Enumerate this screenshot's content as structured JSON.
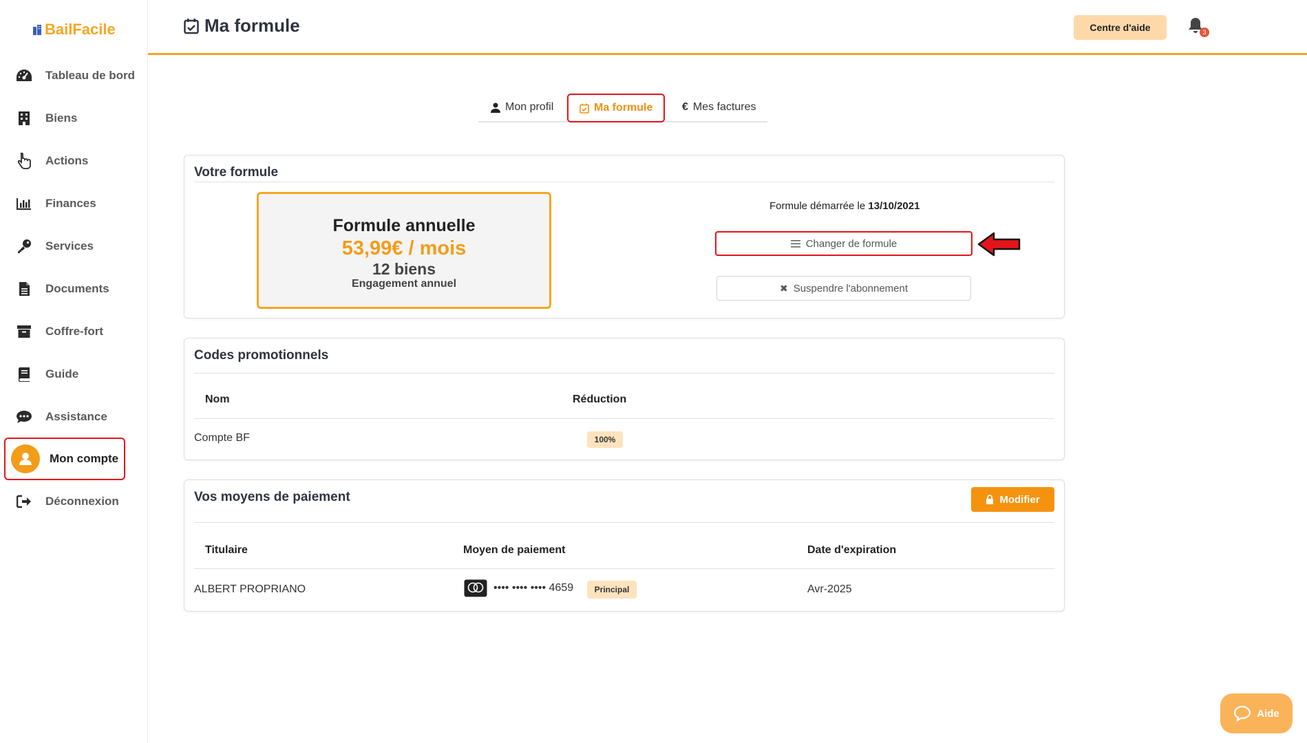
{
  "app": {
    "logo": "BailFacile"
  },
  "sidebar": {
    "items": [
      {
        "label": "Tableau de bord",
        "icon": "dashboard-icon"
      },
      {
        "label": "Biens",
        "icon": "building-icon"
      },
      {
        "label": "Actions",
        "icon": "pointer-hand-icon"
      },
      {
        "label": "Finances",
        "icon": "bar-chart-icon"
      },
      {
        "label": "Services",
        "icon": "key-icon"
      },
      {
        "label": "Documents",
        "icon": "document-icon"
      },
      {
        "label": "Coffre-fort",
        "icon": "archive-icon"
      },
      {
        "label": "Guide",
        "icon": "book-icon"
      },
      {
        "label": "Assistance",
        "icon": "chat-icon"
      },
      {
        "label": "Mon compte",
        "icon": "user-avatar-icon",
        "active": true
      },
      {
        "label": "Déconnexion",
        "icon": "logout-icon"
      }
    ]
  },
  "header": {
    "title": "Ma formule",
    "help_label": "Centre d'aide",
    "notifications_count": "3"
  },
  "tabs": [
    {
      "label": "Mon profil",
      "icon": "user-icon"
    },
    {
      "label": "Ma formule",
      "icon": "calendar-check-icon",
      "active": true
    },
    {
      "label": "Mes factures",
      "icon": "euro-icon"
    }
  ],
  "plan": {
    "section_title": "Votre formule",
    "name": "Formule annuelle",
    "price": "53,99€ / mois",
    "count": "12 biens",
    "engagement": "Engagement annuel",
    "start_prefix": "Formule démarrée le",
    "start_date": "13/10/2021",
    "change_label": "Changer de formule",
    "suspend_label": "Suspendre l'abonnement"
  },
  "promo": {
    "section_title": "Codes promotionnels",
    "columns": [
      "Nom",
      "Réduction"
    ],
    "rows": [
      {
        "name": "Compte BF",
        "reduction": "100%"
      }
    ]
  },
  "payment": {
    "section_title": "Vos moyens de paiement",
    "modify_label": "Modifier",
    "columns": [
      "Titulaire",
      "Moyen de paiement",
      "Date d'expiration"
    ],
    "rows": [
      {
        "holder": "ALBERT PROPRIANO",
        "card_number": "•••• •••• •••• 4659",
        "badge": "Principal",
        "expiry": "Avr-2025"
      }
    ]
  },
  "floating": {
    "aide_label": "Aide"
  },
  "colors": {
    "accent": "#f5a623",
    "highlight": "#e3151a",
    "button": "#f5930f"
  }
}
